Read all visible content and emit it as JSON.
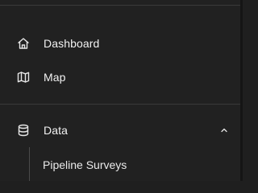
{
  "nav": {
    "dashboard": {
      "label": "Dashboard",
      "icon": "home-icon"
    },
    "map": {
      "label": "Map",
      "icon": "map-icon"
    },
    "data": {
      "label": "Data",
      "icon": "database-icon",
      "expanded": true,
      "chevron": "chevron-up-icon",
      "children": [
        {
          "label": "Pipeline Surveys"
        }
      ]
    }
  },
  "colors": {
    "background": "#212121",
    "divider": "#3a3a3a",
    "text": "#f2f2f2",
    "icon": "#e6e6e6"
  }
}
